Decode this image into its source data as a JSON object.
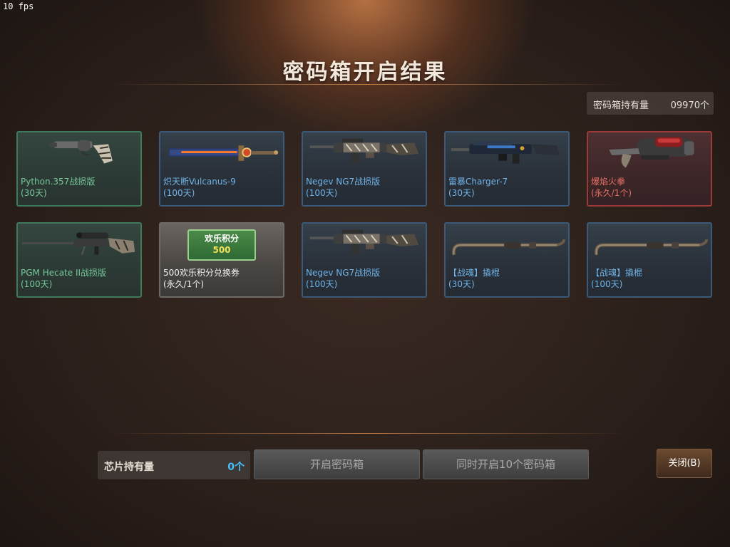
{
  "fps": "10 fps",
  "title": "密码箱开启结果",
  "holding": {
    "label": "密码箱持有量",
    "value": "09970个"
  },
  "items": [
    {
      "name": "Python.357战损版",
      "duration": "(30天)",
      "rarity": "green",
      "icon": "revolver-icon"
    },
    {
      "name": "炽天断Vulcanus-9",
      "duration": "(100天)",
      "rarity": "blue",
      "icon": "sword-icon"
    },
    {
      "name": "Negev NG7战损版",
      "duration": "(100天)",
      "rarity": "blue",
      "icon": "machine-gun-icon"
    },
    {
      "name": "雷暴Charger-7",
      "duration": "(30天)",
      "rarity": "blue",
      "icon": "rifle-icon"
    },
    {
      "name": "爆焰火拳",
      "duration": "(永久/1个)",
      "rarity": "red",
      "icon": "flame-gauntlet-icon"
    },
    {
      "name": "PGM Hecate II战损版",
      "duration": "(100天)",
      "rarity": "green",
      "icon": "sniper-rifle-icon"
    },
    {
      "name": "500欢乐积分兑换券",
      "duration": "(永久/1个)",
      "rarity": "white",
      "icon": "voucher-icon",
      "voucher_text": "欢乐积分",
      "voucher_value": "500"
    },
    {
      "name": "Negev NG7战损版",
      "duration": "(100天)",
      "rarity": "blue",
      "icon": "machine-gun-icon"
    },
    {
      "name": "【战魂】撬棍",
      "duration": "(30天)",
      "rarity": "blue",
      "icon": "crowbar-icon"
    },
    {
      "name": "【战魂】撬棍",
      "duration": "(100天)",
      "rarity": "blue",
      "icon": "crowbar-icon"
    }
  ],
  "chip": {
    "label": "芯片持有量",
    "value": "0个"
  },
  "buttons": {
    "open_one": "开启密码箱",
    "open_ten": "同时开启10个密码箱",
    "close": "关闭(B)"
  },
  "colors": {
    "green": "#76c89a",
    "blue": "#6fb2e6",
    "red": "#e46e62",
    "white": "#f2f2f2",
    "chip_value": "#46c0ff"
  }
}
